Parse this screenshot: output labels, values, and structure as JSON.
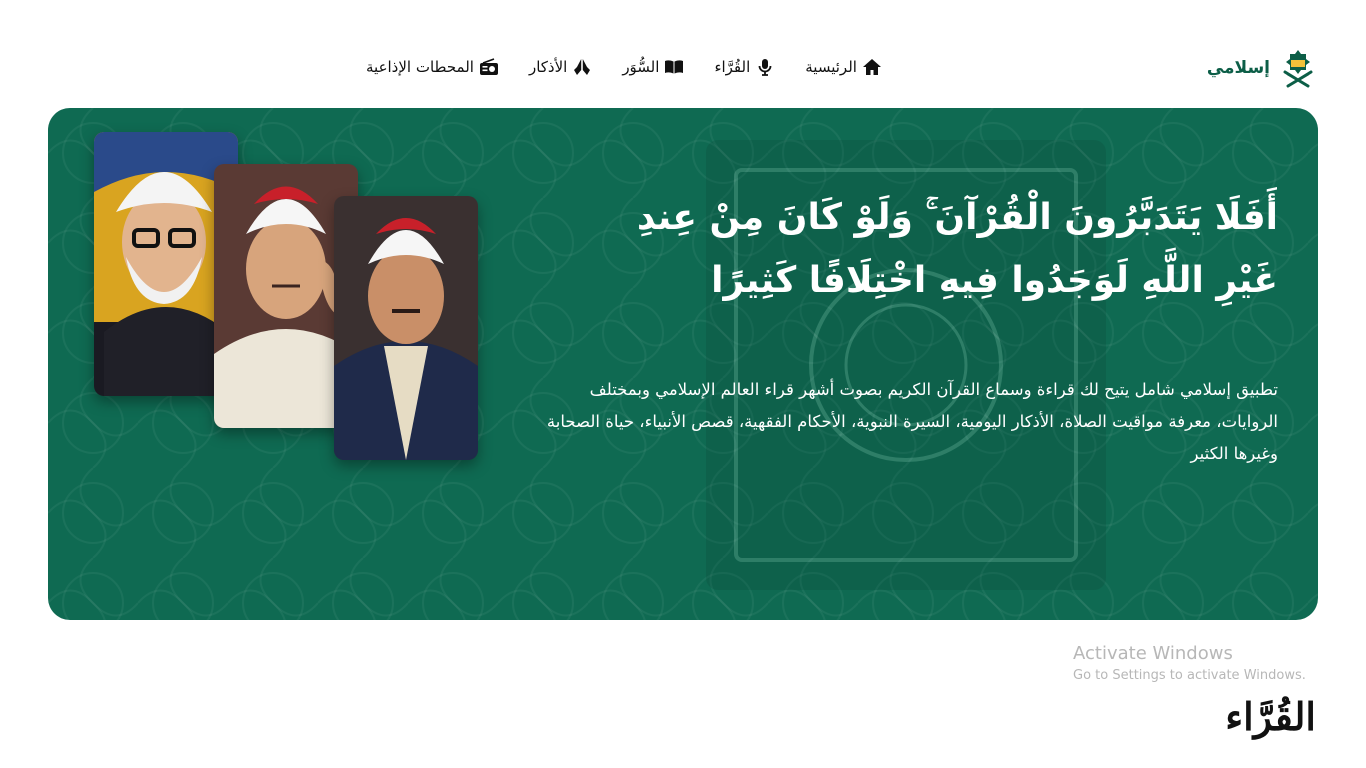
{
  "brand": {
    "name": "إسلامي",
    "logo_icon": "quran-stand-logo-icon",
    "color": "#0c5e47"
  },
  "nav": {
    "items": [
      {
        "label": "الرئيسية",
        "icon": "home-icon"
      },
      {
        "label": "القُرَّاء",
        "icon": "microphone-icon"
      },
      {
        "label": "السُّوَر",
        "icon": "open-book-icon"
      },
      {
        "label": "الأذكار",
        "icon": "praying-hands-icon"
      },
      {
        "label": "المحطات الإذاعية",
        "icon": "radio-icon"
      }
    ]
  },
  "hero": {
    "background_color": "#0f6a52",
    "verse_line_1": "أَفَلَا يَتَدَبَّرُونَ الْقُرْآنَ ۚ وَلَوْ كَانَ مِنْ عِندِ",
    "verse_line_2": "غَيْرِ اللَّهِ لَوَجَدُوا فِيهِ اخْتِلَافًا كَثِيرًا",
    "description": "تطبيق إسلامي شامل يتيح لك قراءة وسماع القرآن الكريم بصوت أشهر قراء العالم الإسلامي وبمختلف الروايات، معرفة مواقيت الصلاة، الأذكار اليومية، السيرة النبوية، الأحكام الفقهية، قصص الأنبياء، حياة الصحابة وغيرها الكثير",
    "readers": [
      {
        "name": "reader-photo-1",
        "style": "sepia-yellow"
      },
      {
        "name": "reader-photo-2",
        "style": "cream-robe"
      },
      {
        "name": "reader-photo-3",
        "style": "dark-robe"
      }
    ]
  },
  "watermark": {
    "title": "Activate Windows",
    "subtitle": "Go to Settings to activate Windows."
  },
  "section": {
    "title": "القُرَّاء"
  }
}
